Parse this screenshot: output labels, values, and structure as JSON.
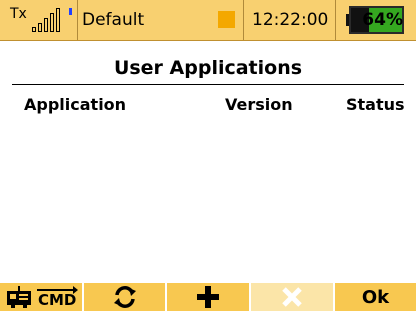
{
  "status_bar": {
    "tx_label": "Tx",
    "model_name": "Default",
    "time": "12:22:00",
    "battery_percent": "64%",
    "battery_level": 0.64,
    "signal_bars": 5,
    "icons": {
      "signal": "signal-strength-icon",
      "model_indicator": "model-indicator-icon",
      "battery": "battery-icon"
    }
  },
  "main": {
    "title": "User Applications",
    "columns": [
      "Application",
      "Version",
      "Status"
    ],
    "rows": []
  },
  "softkeys": [
    {
      "name": "cmd-key",
      "icon": "transmitter-cmd-icon",
      "label": "CMD",
      "enabled": true
    },
    {
      "name": "refresh-key",
      "icon": "refresh-icon",
      "label": "",
      "enabled": true
    },
    {
      "name": "add-key",
      "icon": "plus-icon",
      "label": "",
      "enabled": true
    },
    {
      "name": "delete-key",
      "icon": "close-icon",
      "label": "",
      "enabled": false
    },
    {
      "name": "ok-key",
      "icon": "",
      "label": "Ok",
      "enabled": true
    }
  ],
  "colors": {
    "status_bar_bg": "#f8d070",
    "softkey_bg": "#f8c850",
    "softkey_disabled_bg": "#fbe5a8",
    "battery_green": "#35a820",
    "model_indicator": "#f4a800",
    "signal_dot": "#2040ff"
  }
}
